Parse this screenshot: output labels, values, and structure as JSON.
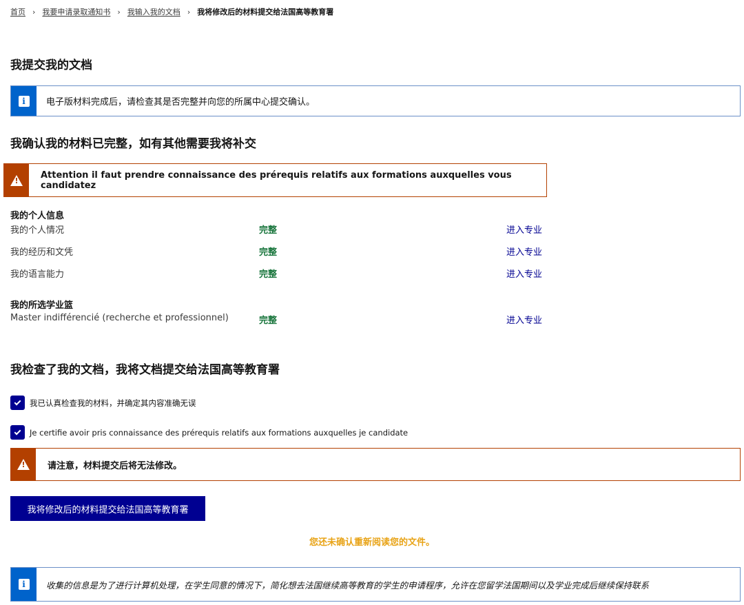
{
  "breadcrumb": {
    "items": [
      "首页",
      "我要申请录取通知书",
      "我输入我的文档"
    ],
    "current": "我将修改后的材料提交给法国高等教育署"
  },
  "page_title": "我提交我的文档",
  "info_notice": "电子版材料完成后，请检查其是否完整并向您的所属中心提交确认。",
  "confirm_heading": "我确认我的材料已完整，如有其他需要我将补交",
  "attention_notice": "Attention il faut prendre connaissance des prérequis relatifs aux formations auxquelles vous candidatez",
  "personal_info": {
    "label": "我的个人信息",
    "rows": [
      {
        "name": "我的个人情况",
        "status": "完整",
        "link": "进入专业"
      },
      {
        "name": "我的经历和文凭",
        "status": "完整",
        "link": "进入专业"
      },
      {
        "name": "我的语言能力",
        "status": "完整",
        "link": "进入专业"
      }
    ]
  },
  "basket": {
    "label": "我的所选学业篮",
    "rows": [
      {
        "name": "Master indifférencié (recherche et professionnel)",
        "status": "完整",
        "link": "进入专业"
      }
    ]
  },
  "checked_heading": "我检查了我的文档，我将文档提交给法国高等教育署",
  "checkboxes": [
    {
      "label": "我已认真检查我的材料，并确定其内容准确无误",
      "checked": true
    },
    {
      "label": "Je certifie avoir pris connaissance des prérequis relatifs aux formations auxquelles je candidate",
      "checked": true
    }
  ],
  "caution_notice": "请注意，材料提交后将无法修改。",
  "submit_button": "我将修改后的材料提交给法国高等教育署",
  "unconfirmed_warning": "您还未确认重新阅读您的文件。",
  "privacy_notice": "收集的信息是为了进行计算机处理，在学生同意的情况下，简化想去法国继续高等教育的学生的申请程序，允许在您留学法国期间以及学业完成后继续保持联系",
  "colors": {
    "primary": "#000091",
    "info": "#0063cb",
    "warning": "#b34000",
    "success": "#18753c",
    "alert_text": "#e8a316"
  },
  "icons": [
    "info-icon",
    "warning-icon",
    "checkmark-icon",
    "chevron-right-icon"
  ]
}
